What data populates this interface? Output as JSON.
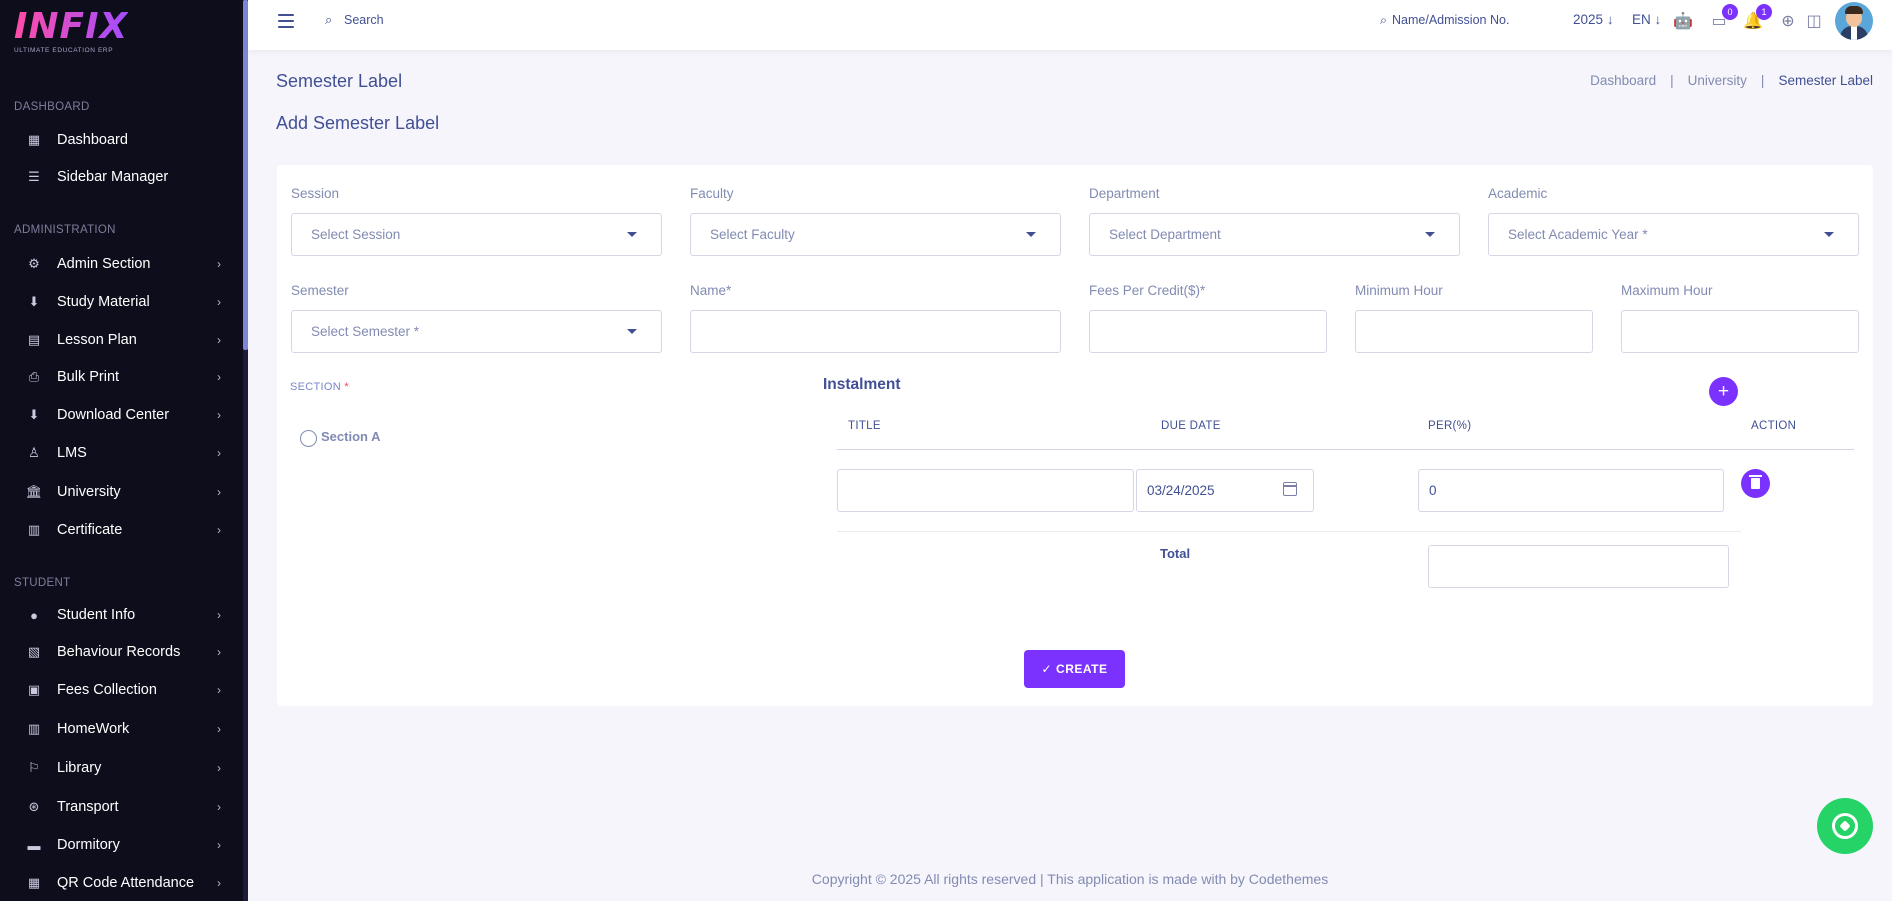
{
  "brand": {
    "logo": "INFIX",
    "tagline": "ULTIMATE EDUCATION ERP"
  },
  "sidebar": {
    "sections": [
      {
        "title": "DASHBOARD",
        "items": [
          {
            "label": "Dashboard",
            "icon": "grid-icon",
            "chevron": false
          },
          {
            "label": "Sidebar Manager",
            "icon": "menu-icon",
            "chevron": false
          }
        ]
      },
      {
        "title": "ADMINISTRATION",
        "items": [
          {
            "label": "Admin Section",
            "icon": "admin-icon",
            "chevron": true
          },
          {
            "label": "Study Material",
            "icon": "download-icon",
            "chevron": true
          },
          {
            "label": "Lesson Plan",
            "icon": "lesson-icon",
            "chevron": true
          },
          {
            "label": "Bulk Print",
            "icon": "printer-icon",
            "chevron": true
          },
          {
            "label": "Download Center",
            "icon": "download-icon",
            "chevron": true
          },
          {
            "label": "LMS",
            "icon": "lms-icon",
            "chevron": true
          },
          {
            "label": "University",
            "icon": "university-icon",
            "chevron": true
          },
          {
            "label": "Certificate",
            "icon": "book-icon",
            "chevron": true
          }
        ]
      },
      {
        "title": "STUDENT",
        "items": [
          {
            "label": "Student Info",
            "icon": "user-icon",
            "chevron": true
          },
          {
            "label": "Behaviour Records",
            "icon": "records-icon",
            "chevron": true
          },
          {
            "label": "Fees Collection",
            "icon": "fees-icon",
            "chevron": true
          },
          {
            "label": "HomeWork",
            "icon": "book-icon",
            "chevron": true
          },
          {
            "label": "Library",
            "icon": "library-icon",
            "chevron": true
          },
          {
            "label": "Transport",
            "icon": "transport-icon",
            "chevron": true
          },
          {
            "label": "Dormitory",
            "icon": "bed-icon",
            "chevron": true
          },
          {
            "label": "QR Code Attendance",
            "icon": "qr-icon",
            "chevron": true
          }
        ]
      }
    ]
  },
  "header": {
    "search_label": "Search",
    "admission_search": "Name/Admission No.",
    "year": "2025",
    "language": "EN",
    "chat_count": "0",
    "notification_count": "1"
  },
  "page": {
    "title": "Semester Label",
    "breadcrumb": [
      "Dashboard",
      "University",
      "Semester Label"
    ],
    "subtitle": "Add Semester Label"
  },
  "form": {
    "session": {
      "label": "Session",
      "placeholder": "Select Session"
    },
    "faculty": {
      "label": "Faculty",
      "placeholder": "Select Faculty"
    },
    "department": {
      "label": "Department",
      "placeholder": "Select Department"
    },
    "academic": {
      "label": "Academic",
      "placeholder": "Select Academic Year *"
    },
    "semester": {
      "label": "Semester",
      "placeholder": "Select Semester *"
    },
    "name": {
      "label": "Name*",
      "value": ""
    },
    "fees": {
      "label": "Fees Per Credit($)*",
      "value": ""
    },
    "min_hour": {
      "label": "Minimum Hour",
      "value": ""
    },
    "max_hour": {
      "label": "Maximum Hour",
      "value": ""
    },
    "section": {
      "label": "SECTION",
      "required_mark": "*",
      "options": [
        "Section A"
      ]
    }
  },
  "instalment": {
    "title": "Instalment",
    "columns": [
      "TITLE",
      "DUE DATE",
      "PER(%)",
      "ACTION"
    ],
    "rows": [
      {
        "title": "",
        "due_date": "03/24/2025",
        "percent": "0"
      }
    ],
    "total_label": "Total",
    "total_value": ""
  },
  "create_label": "CREATE",
  "footer": "Copyright © 2025 All rights reserved | This application is made with by Codethemes",
  "colors": {
    "accent": "#7c32ff",
    "text": "#415094",
    "muted": "#828bb2",
    "sidebar_bg": "#0d0d1c",
    "whatsapp": "#25d366"
  }
}
